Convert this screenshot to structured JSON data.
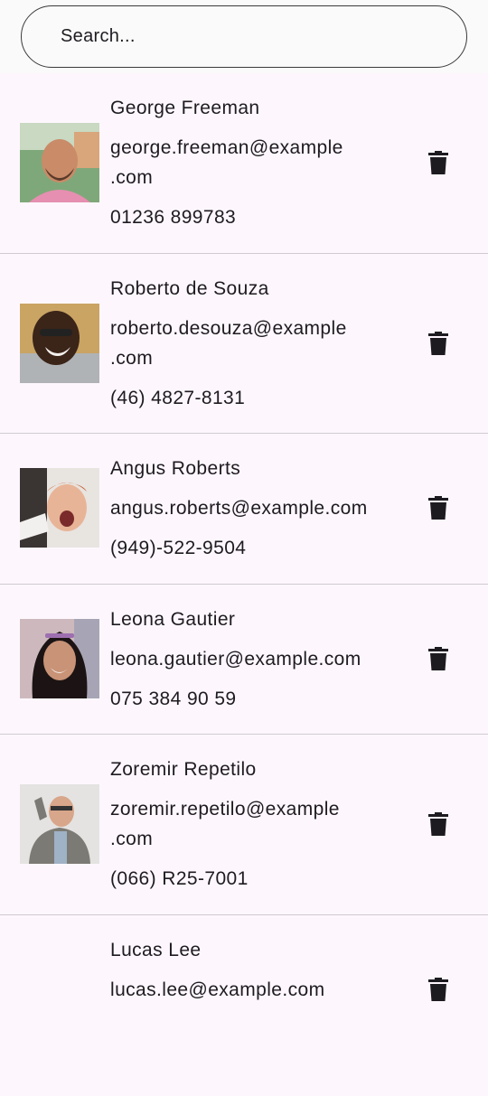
{
  "search": {
    "placeholder": "Search..."
  },
  "contacts": [
    {
      "name": "George Freeman",
      "email": "george.freeman@example\n.com",
      "phone": "01236 899783"
    },
    {
      "name": "Roberto de Souza",
      "email": "roberto.desouza@example\n.com",
      "phone": "(46) 4827-8131"
    },
    {
      "name": "Angus Roberts",
      "email": "angus.roberts@example.com",
      "phone": "(949)-522-9504"
    },
    {
      "name": "Leona Gautier",
      "email": "leona.gautier@example.com",
      "phone": "075 384 90 59"
    },
    {
      "name": "Zoremir Repetilo",
      "email": "zoremir.repetilo@example\n.com",
      "phone": "(066) R25-7001"
    },
    {
      "name": "Lucas Lee",
      "email": "lucas.lee@example.com",
      "phone": ""
    }
  ],
  "icons": {
    "delete": "trash-icon",
    "avatar": "person-photo"
  },
  "colors": {
    "background": "#fdf7fd",
    "divider": "#cfcbd0",
    "text": "#1e1b20",
    "icon": "#1e1b20"
  }
}
